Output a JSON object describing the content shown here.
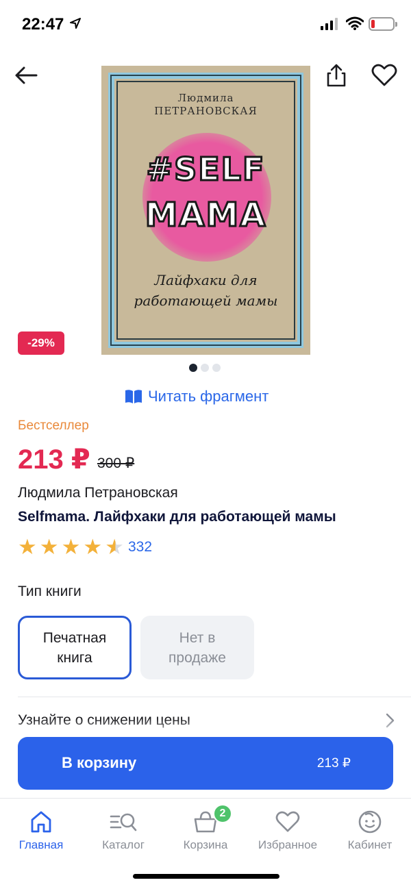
{
  "status_bar": {
    "time": "22:47"
  },
  "product": {
    "cover": {
      "author": "Людмила\nПЕТРАНОВСКАЯ",
      "title_line1": "#SELF",
      "title_line2": "MAMA",
      "subtitle": "Лайфхаки для\nработающей мамы"
    },
    "discount": "-29%",
    "images_total": 3,
    "images_active": 1,
    "read_fragment": "Читать фрагмент",
    "badge": "Бестселлер",
    "price": "213 ₽",
    "old_price": "300 ₽",
    "author": "Людмила Петрановская",
    "title": "Selfmama. Лайфхаки для работающей мамы",
    "rating": 4.5,
    "reviews_count": "332"
  },
  "book_type": {
    "label": "Тип книги",
    "options": [
      {
        "label": "Печатная\nкнига",
        "selected": true
      },
      {
        "label": "Нет в\nпродаже",
        "selected": false
      }
    ]
  },
  "price_alert": "Узнайте о снижении цены",
  "cart_button": {
    "label": "В корзину",
    "price": "213 ₽"
  },
  "tabbar": {
    "items": [
      {
        "label": "Главная",
        "icon": "home-icon",
        "active": true
      },
      {
        "label": "Каталог",
        "icon": "catalog-search-icon",
        "active": false
      },
      {
        "label": "Корзина",
        "icon": "cart-icon",
        "active": false,
        "badge": "2"
      },
      {
        "label": "Избранное",
        "icon": "heart-icon",
        "active": false
      },
      {
        "label": "Кабинет",
        "icon": "profile-icon",
        "active": false
      }
    ]
  },
  "colors": {
    "accent": "#2b62ea",
    "price": "#e32952",
    "bestseller": "#e9893a",
    "star": "#f3b13a",
    "badge_green": "#4fc36b"
  }
}
